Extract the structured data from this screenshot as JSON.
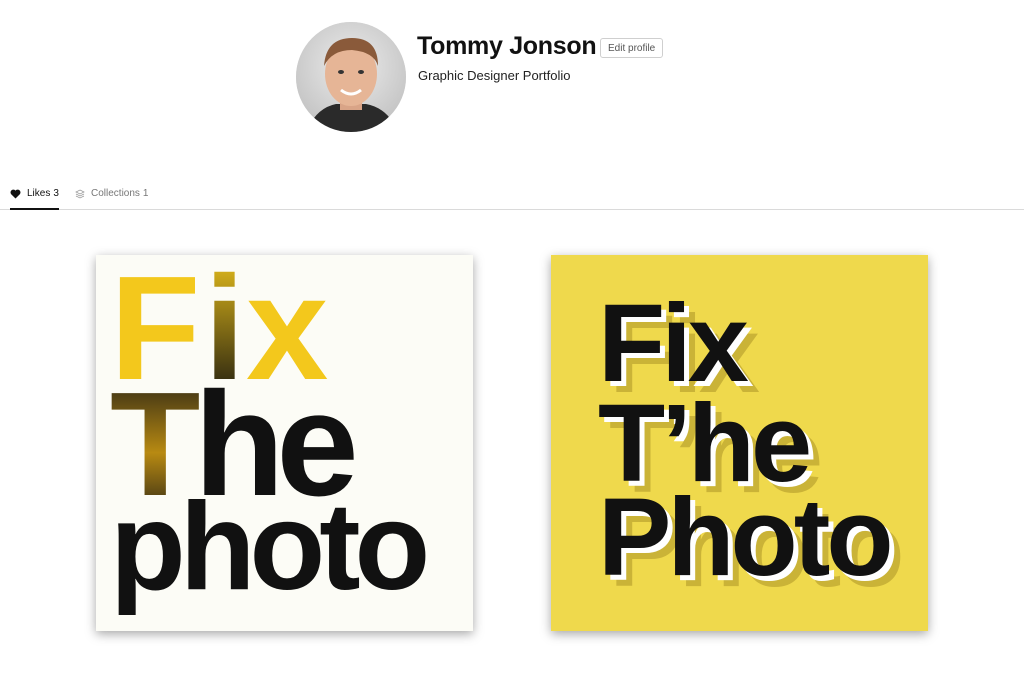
{
  "profile": {
    "name": "Tommy Jonson",
    "edit_label": "Edit profile",
    "subtitle": "Graphic Designer Portfolio"
  },
  "tabs": [
    {
      "label": "Likes",
      "count": "3",
      "icon": "heart-icon",
      "active": true
    },
    {
      "label": "Collections",
      "count": "1",
      "icon": "stack-icon",
      "active": false
    }
  ],
  "cards": [
    {
      "word1_part1": "F",
      "word1_part2": "i",
      "word1_part3": "x",
      "word2_part1": "T",
      "word2_part2": "he",
      "word3": "photo",
      "accent": "#f3c81c"
    },
    {
      "word1": "Fix",
      "word2": "T’he",
      "word3": "Photo",
      "background": "#efd94c"
    }
  ]
}
